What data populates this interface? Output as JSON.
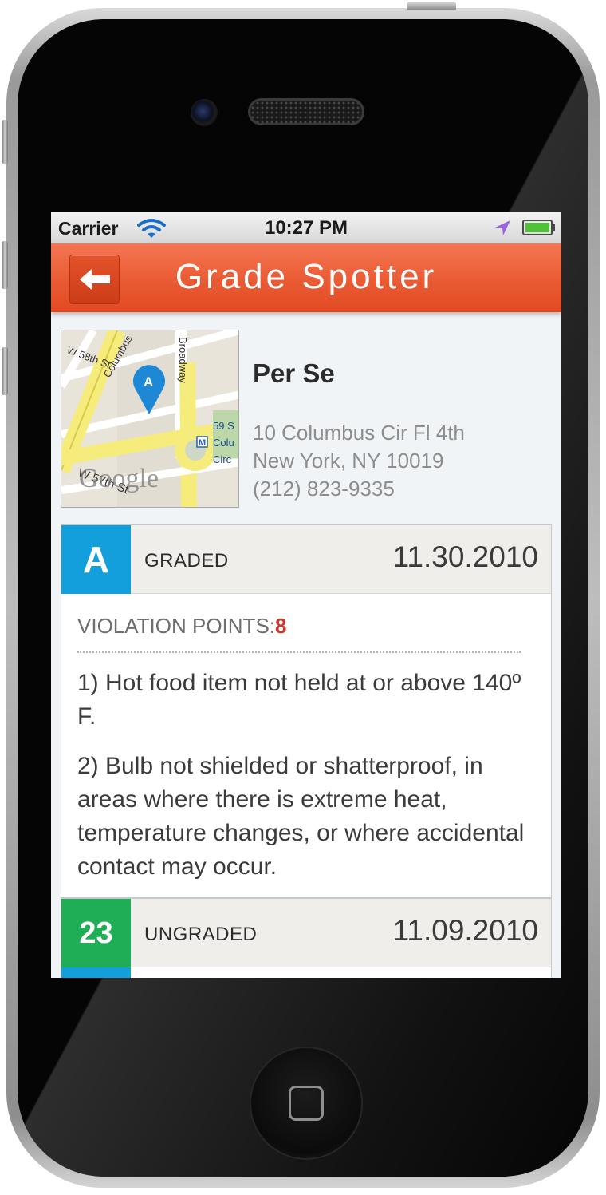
{
  "status_bar": {
    "carrier": "Carrier",
    "time": "10:27 PM",
    "icons": [
      "wifi-icon",
      "location-arrow-icon",
      "battery-icon"
    ]
  },
  "nav": {
    "title": "Grade Spotter",
    "back_icon": "back-arrow-icon",
    "color": "#ea5b33"
  },
  "restaurant": {
    "name": "Per Se",
    "address_line1": "10 Columbus Cir Fl 4th",
    "address_line2": "New York, NY 10019",
    "phone": "(212) 823-9335",
    "map": {
      "pin_label": "A",
      "watermark": "Google",
      "streets": [
        "Columbus",
        "Broadway",
        "W 57th St",
        "W 58th St"
      ],
      "station_lines": [
        "59 S",
        "Colu",
        "Circ"
      ],
      "station_icon": "M"
    }
  },
  "inspections": [
    {
      "grade": "A",
      "status": "GRADED",
      "date": "11.30.2010",
      "color": "#139fdc",
      "violation_label": "VIOLATION POINTS:",
      "violation_points": "8",
      "violations": [
        "1) Hot food item not held at or above 140º F.",
        "2) Bulb not shielded or shatterproof, in areas where there is extreme heat, temperature changes, or where accidental contact may occur."
      ]
    },
    {
      "grade": "23",
      "status": "UNGRADED",
      "date": "11.09.2010",
      "color": "#1fae55"
    }
  ]
}
